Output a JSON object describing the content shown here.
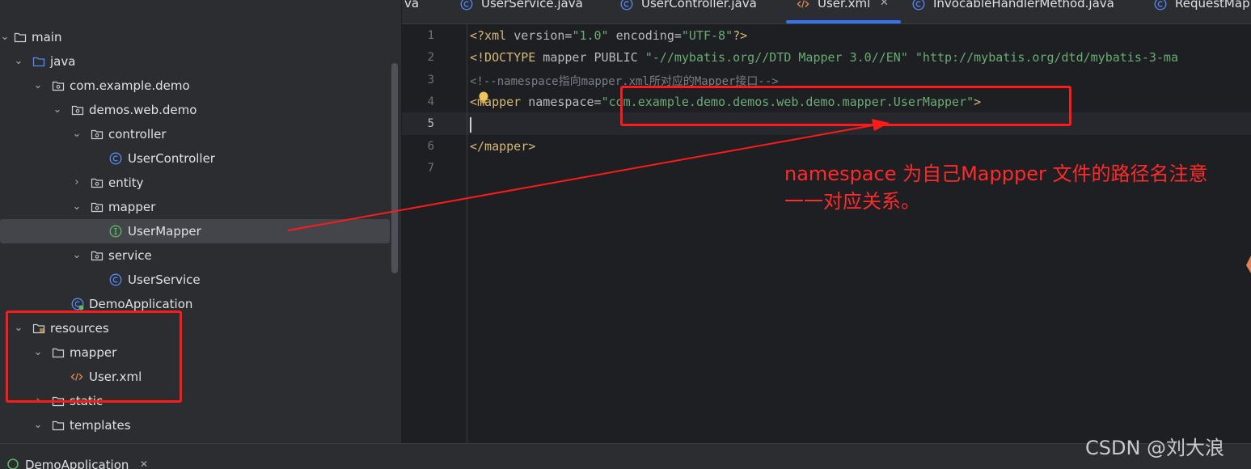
{
  "tabs": [
    {
      "label": "va",
      "icon": "java-file-icon",
      "active": false
    },
    {
      "label": "UserService.java",
      "icon": "class-icon",
      "active": false
    },
    {
      "label": "UserController.java",
      "icon": "class-icon",
      "active": false
    },
    {
      "label": "User.xml",
      "icon": "xml-icon",
      "active": true
    },
    {
      "label": "InvocableHandlerMethod.java",
      "icon": "class-icon",
      "active": false
    },
    {
      "label": "RequestMap",
      "icon": "class-icon",
      "active": false
    }
  ],
  "tab_close_glyph": "✕",
  "tree": [
    {
      "label": "main",
      "kind": "folder",
      "expanded": true
    },
    {
      "label": "java",
      "kind": "source-folder",
      "expanded": true
    },
    {
      "label": "com.example.demo",
      "kind": "package",
      "expanded": true
    },
    {
      "label": "demos.web.demo",
      "kind": "package",
      "expanded": true
    },
    {
      "label": "controller",
      "kind": "package",
      "expanded": true
    },
    {
      "label": "UserController",
      "kind": "class"
    },
    {
      "label": "entity",
      "kind": "package",
      "expanded": false
    },
    {
      "label": "mapper",
      "kind": "package",
      "expanded": true
    },
    {
      "label": "UserMapper",
      "kind": "interface",
      "selected": true
    },
    {
      "label": "service",
      "kind": "package",
      "expanded": true
    },
    {
      "label": "UserService",
      "kind": "class"
    },
    {
      "label": "DemoApplication",
      "kind": "spring-class"
    },
    {
      "label": "resources",
      "kind": "resources-folder",
      "expanded": true
    },
    {
      "label": "mapper",
      "kind": "folder",
      "expanded": true
    },
    {
      "label": "User.xml",
      "kind": "xml"
    },
    {
      "label": "static",
      "kind": "folder",
      "expanded": false
    },
    {
      "label": "templates",
      "kind": "folder",
      "expanded": true
    }
  ],
  "editor": {
    "line_numbers": [
      "1",
      "2",
      "3",
      "4",
      "5",
      "6",
      "7"
    ],
    "line1": {
      "open": "<?xml ",
      "a1": "version=",
      "v1": "\"1.0\"",
      "a2": " encoding=",
      "v2": "\"UTF-8\"",
      "close": "?>"
    },
    "line2": {
      "kw": "<!DOCTYPE",
      "txt": " mapper PUBLIC ",
      "s1": "\"-//mybatis.org//DTD Mapper 3.0//EN\"",
      "s2": " \"http://mybatis.org/dtd/mybatis-3-ma"
    },
    "line3": {
      "comment": "<!--namespace指向mapper.xml所对应的Mapper接口-->"
    },
    "line4": {
      "open": "<mapper",
      "attr": " namespace=",
      "val": "\"com.example.demo.demos.web.demo.mapper.UserMapper\"",
      "close": ">"
    },
    "line6": {
      "close": "</mapper>"
    }
  },
  "annotation": {
    "text_line1": "namespace 为自己Mappper 文件的路径名注意",
    "text_line2": "一一对应关系。",
    "color": "#ff1a1a"
  },
  "bottom": {
    "run_tab_label": "DemoApplication",
    "close_glyph": "✕"
  },
  "watermark": "CSDN @刘大浪",
  "colors": {
    "accent": "#3574f0",
    "tree_bg": "#2b2d30",
    "editor_bg": "#1e1f22",
    "string": "#6aab73",
    "tag": "#d5b778"
  }
}
